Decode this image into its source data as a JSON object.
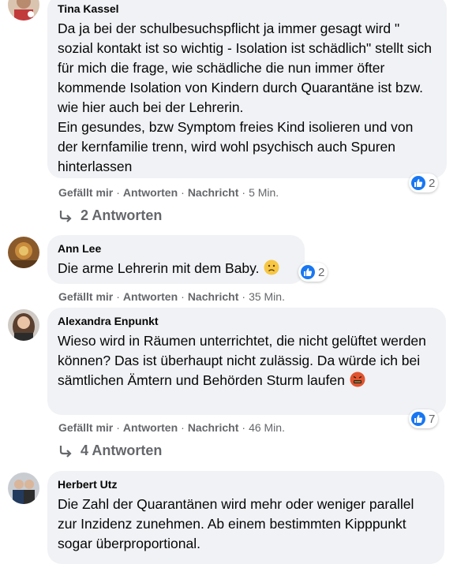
{
  "comments": [
    {
      "author": "Tina Kassel",
      "paragraphs": [
        "Da ja bei der schulbesuchspflicht ja immer gesagt wird \" sozial kontakt ist so wichtig - Isolation ist schädlich\" stellt sich für mich die frage, wie schädliche die nun immer öfter kommende Isolation von Kindern durch Quarantäne ist bzw. wie hier auch bei der Lehrerin.",
        "Ein gesundes, bzw Symptom freies Kind isolieren und von der kernfamilie trenn, wird wohl psychisch auch Spuren hinterlassen"
      ],
      "reactions": "2",
      "like_label": "Gefällt mir",
      "reply_label": "Antworten",
      "message_label": "Nachricht",
      "time": "5 Min.",
      "replies_label": "2 Antworten"
    },
    {
      "author": "Ann Lee",
      "text": "Die arme Lehrerin mit dem Baby.",
      "emoji": "sad-face",
      "reactions": "2",
      "like_label": "Gefällt mir",
      "reply_label": "Antworten",
      "message_label": "Nachricht",
      "time": "35 Min."
    },
    {
      "author": "Alexandra Enpunkt",
      "text": "Wieso wird in Räumen unterrichtet, die nicht gelüftet werden können? Das ist überhaupt nicht zulässig. Da würde ich bei sämtlichen Ämtern und Behörden Sturm laufen",
      "emoji": "angry-cursing-face",
      "reactions": "7",
      "like_label": "Gefällt mir",
      "reply_label": "Antworten",
      "message_label": "Nachricht",
      "time": "46 Min.",
      "replies_label": "4 Antworten"
    },
    {
      "author": "Herbert Utz",
      "text": "Die Zahl der Quarantänen wird mehr oder weniger parallel zur Inzidenz zunehmen. Ab einem bestimmten Kipppunkt sogar überproportional."
    }
  ],
  "colors": {
    "bubble": "#f0f2f5",
    "meta": "#65676b",
    "like_blue": "#1877f2"
  }
}
